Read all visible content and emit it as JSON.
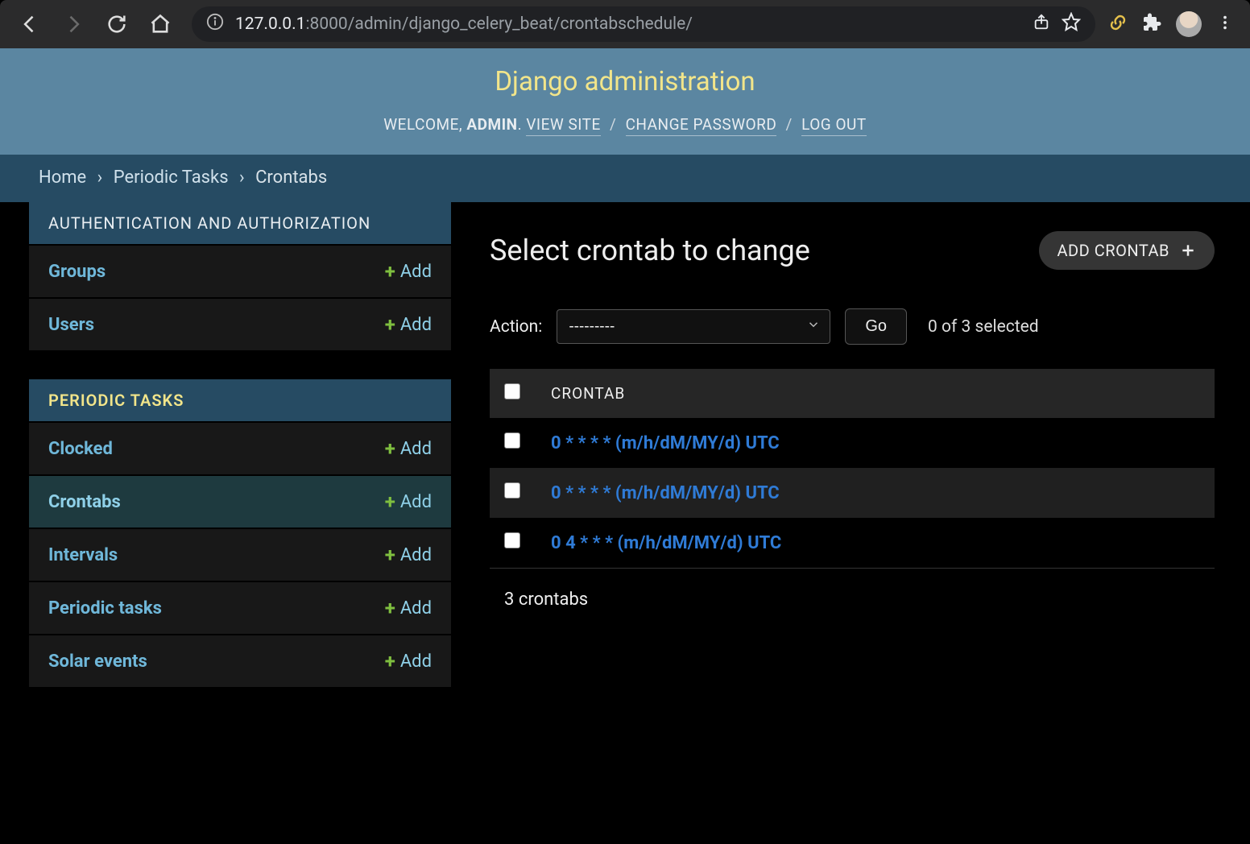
{
  "browser": {
    "url_prefix": "127.0.0.1",
    "url_suffix": ":8000/admin/django_celery_beat/crontabschedule/"
  },
  "header": {
    "title": "Django administration",
    "welcome": "WELCOME,",
    "username": "ADMIN",
    "view_site": "VIEW SITE",
    "change_password": "CHANGE PASSWORD",
    "log_out": "LOG OUT"
  },
  "breadcrumbs": {
    "home": "Home",
    "app": "Periodic Tasks",
    "model": "Crontabs"
  },
  "sidebar": {
    "auth": {
      "caption": "AUTHENTICATION AND AUTHORIZATION",
      "items": [
        {
          "label": "Groups",
          "add": "Add"
        },
        {
          "label": "Users",
          "add": "Add"
        }
      ]
    },
    "periodic": {
      "caption": "PERIODIC TASKS",
      "items": [
        {
          "label": "Clocked",
          "add": "Add",
          "active": false
        },
        {
          "label": "Crontabs",
          "add": "Add",
          "active": true
        },
        {
          "label": "Intervals",
          "add": "Add",
          "active": false
        },
        {
          "label": "Periodic tasks",
          "add": "Add",
          "active": false
        },
        {
          "label": "Solar events",
          "add": "Add",
          "active": false
        }
      ]
    }
  },
  "content": {
    "title": "Select crontab to change",
    "add_button": "ADD CRONTAB",
    "action_label": "Action:",
    "action_placeholder": "---------",
    "go_label": "Go",
    "selection_count": "0 of 3 selected",
    "table_header": "CRONTAB",
    "rows": [
      "0 * * * * (m/h/dM/MY/d) UTC",
      "0 * * * * (m/h/dM/MY/d) UTC",
      "0 4 * * * (m/h/dM/MY/d) UTC"
    ],
    "paginator": "3 crontabs"
  }
}
